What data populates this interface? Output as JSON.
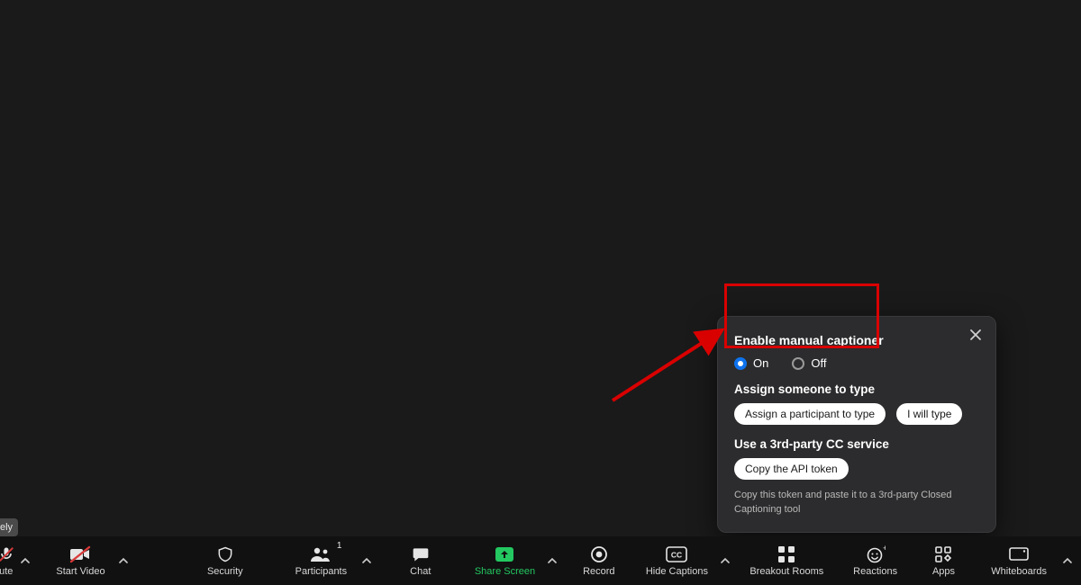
{
  "panel": {
    "enable_title": "Enable manual captioner",
    "on": "On",
    "off": "Off",
    "assign_title": "Assign someone to type",
    "assign_btn": "Assign a participant to type",
    "i_type_btn": "I will type",
    "third_party_title": "Use a 3rd-party CC service",
    "copy_token_btn": "Copy the API token",
    "hint": "Copy this token and paste it to a 3rd-party Closed Captioning tool"
  },
  "toolbar": {
    "mute": "ute",
    "start_video": "Start Video",
    "security": "Security",
    "participants": "Participants",
    "participants_count": "1",
    "chat": "Chat",
    "share": "Share Screen",
    "record": "Record",
    "captions": "Hide Captions",
    "breakout": "Breakout Rooms",
    "reactions": "Reactions",
    "apps": "Apps",
    "whiteboards": "Whiteboards"
  },
  "ghost": "ely"
}
